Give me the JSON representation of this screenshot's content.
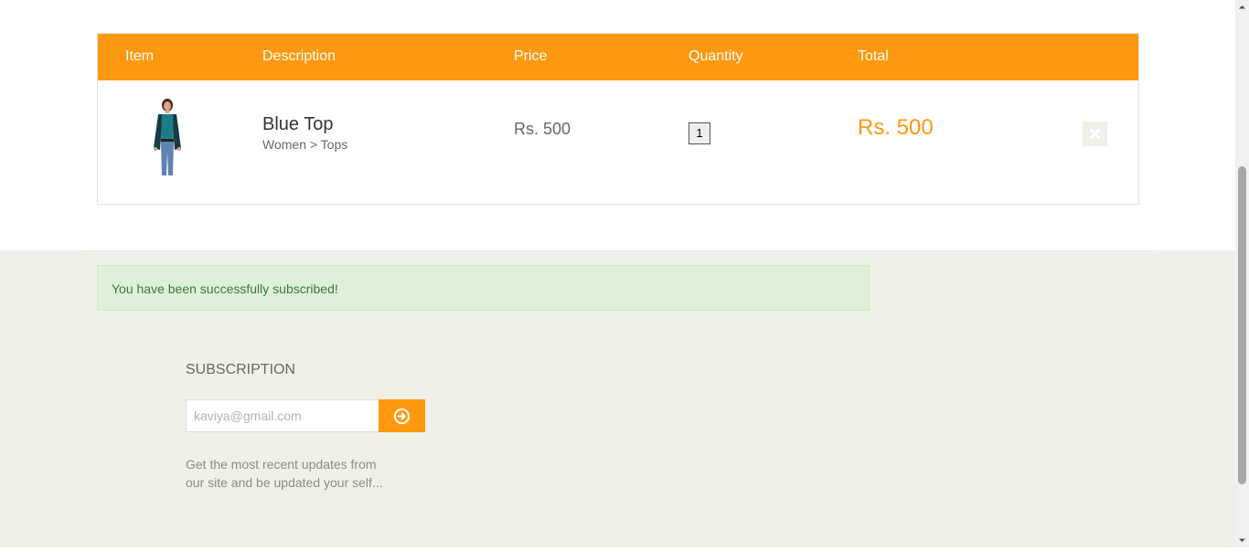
{
  "cart": {
    "headers": {
      "item": "Item",
      "description": "Description",
      "price": "Price",
      "quantity": "Quantity",
      "total": "Total"
    },
    "items": [
      {
        "name": "Blue Top",
        "category": "Women > Tops",
        "price": "Rs. 500",
        "quantity": "1",
        "total": "Rs. 500",
        "delete_icon": "close-icon"
      }
    ]
  },
  "footer": {
    "alert": "You have been successfully subscribed!",
    "subscription": {
      "title": "SUBSCRIPTION",
      "email_value": "kaviya@gmail.com",
      "submit_icon": "arrow-circle-right-icon",
      "description": "Get the most recent updates from our site and be updated your self..."
    }
  },
  "colors": {
    "accent": "#fe980f",
    "alert_bg": "#dff0d8",
    "alert_text": "#3c763d",
    "footer_bg": "#f0f0e9"
  }
}
